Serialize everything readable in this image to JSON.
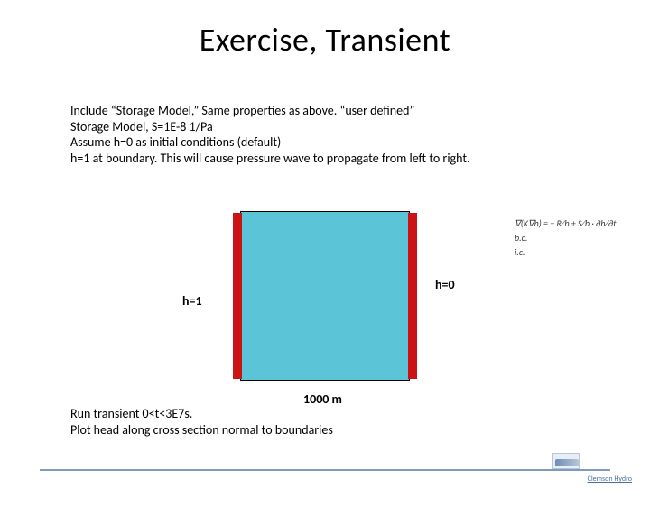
{
  "title": "Exercise, Transient",
  "body": {
    "line1": "Include “Storage Model,”  Same properties as above.  “user defined”",
    "line2": "Storage Model, S=1E-8 1/Pa",
    "line3": "Assume h=0 as initial conditions (default)",
    "line4": "h=1 at boundary.  This will cause pressure wave to propagate from left to right."
  },
  "diagram": {
    "left_label": "h=1",
    "right_label": "h=0",
    "width_label": "1000 m"
  },
  "equation": {
    "main": "∇(K∇h) = − R⁄b + S⁄b · ∂h⁄∂t",
    "bc": "b.c.",
    "ic": "i.c."
  },
  "bottom": {
    "line1": "Run transient 0<t<3E7s.",
    "line2": "Plot head along cross section normal to boundaries"
  },
  "footer": {
    "label": "Clemson Hydro"
  }
}
